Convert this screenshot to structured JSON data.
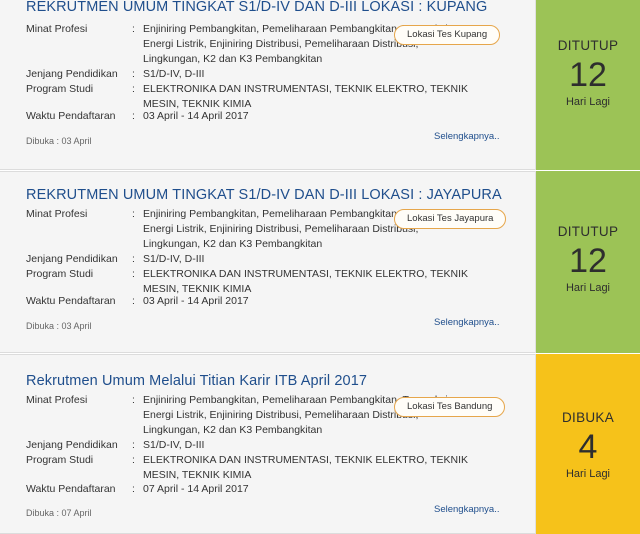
{
  "labels": {
    "minat_profesi": "Minat Profesi",
    "jenjang_pendidikan": "Jenjang Pendidikan",
    "program_studi": "Program Studi",
    "waktu_pendaftaran": "Waktu Pendaftaran",
    "separator": ":",
    "selengkapnya": "Selengkapnya..",
    "hari_lagi": "Hari Lagi"
  },
  "cards": [
    {
      "title": "REKRUTMEN UMUM TINGKAT S1/D-IV DAN D-III LOKASI : KUPANG",
      "minat_profesi": "Enjiniring Pembangkitan, Pemeliharaan Pembangkitan, Transaksi Energi Listrik, Enjiniring Distribusi, Pemeliharaan Distribusi, Lingkungan, K2 dan K3 Pembangkitan",
      "jenjang_pendidikan": "S1/D-IV, D-III",
      "program_studi": "ELEKTRONIKA DAN INSTRUMENTASI, TEKNIK ELEKTRO, TEKNIK MESIN, TEKNIK KIMIA",
      "waktu_pendaftaran": "03 April - 14 April 2017",
      "dibuka": "Dibuka : 03 April",
      "lokasi_button": "Lokasi Tes Kupang",
      "status": "DITUTUP",
      "days": "12",
      "status_color": "#9cc356"
    },
    {
      "title": "REKRUTMEN UMUM TINGKAT S1/D-IV DAN D-III LOKASI : JAYAPURA",
      "minat_profesi": "Enjiniring Pembangkitan, Pemeliharaan Pembangkitan, Transaksi Energi Listrik, Enjiniring Distribusi, Pemeliharaan Distribusi, Lingkungan, K2 dan K3 Pembangkitan",
      "jenjang_pendidikan": "S1/D-IV, D-III",
      "program_studi": "ELEKTRONIKA DAN INSTRUMENTASI, TEKNIK ELEKTRO, TEKNIK MESIN, TEKNIK KIMIA",
      "waktu_pendaftaran": "03 April - 14 April 2017",
      "dibuka": "Dibuka : 03 April",
      "lokasi_button": "Lokasi Tes Jayapura",
      "status": "DITUTUP",
      "days": "12",
      "status_color": "#9cc356"
    },
    {
      "title": "Rekrutmen Umum Melalui Titian Karir ITB April 2017",
      "minat_profesi": "Enjiniring Pembangkitan, Pemeliharaan Pembangkitan, Transaksi Energi Listrik, Enjiniring Distribusi, Pemeliharaan Distribusi, Lingkungan, K2 dan K3 Pembangkitan",
      "jenjang_pendidikan": "S1/D-IV, D-III",
      "program_studi": "ELEKTRONIKA DAN INSTRUMENTASI, TEKNIK ELEKTRO, TEKNIK MESIN, TEKNIK KIMIA",
      "waktu_pendaftaran": "07 April - 14 April 2017",
      "dibuka": "Dibuka : 07 April",
      "lokasi_button": "Lokasi Tes Bandung",
      "status": "DIBUKA",
      "days": "4",
      "status_color": "#f6c21a"
    }
  ]
}
